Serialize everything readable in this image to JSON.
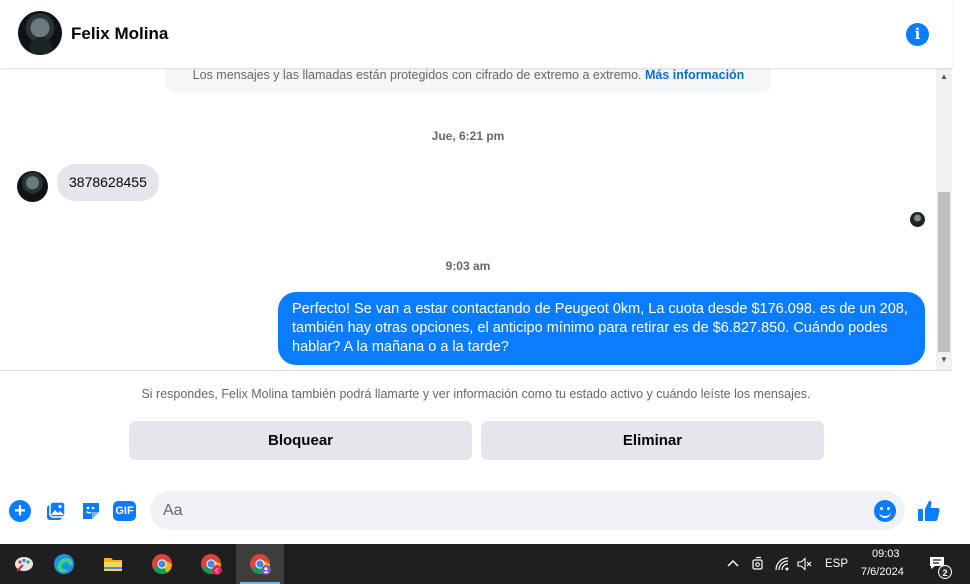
{
  "header": {
    "contact_name": "Felix Molina",
    "info_icon": "info-icon"
  },
  "thread": {
    "e2ee_text": "Los mensajes y las llamadas están protegidos con cifrado de extremo a extremo.",
    "e2ee_link": "Más información",
    "timestamp_1": "Jue, 6:21 pm",
    "incoming_message": "3878628455",
    "timestamp_2": "9:03 am",
    "outgoing_message": "Perfecto!  Se van a estar contactando de Peugeot 0km, La cuota desde $176.098. es de un 208, también hay otras opciones, el anticipo mínimo para retirar es de $6.827.850. Cuándo podes hablar? A la mañana o a la tarde?"
  },
  "request_panel": {
    "notice": "Si respondes, Felix Molina también podrá llamarte y ver información como tu estado activo y cuándo leíste los mensajes.",
    "block_label": "Bloquear",
    "delete_label": "Eliminar"
  },
  "composer": {
    "placeholder": "Aa",
    "gif_label": "GIF",
    "plus_label": "+"
  },
  "taskbar": {
    "language": "ESP",
    "time": "09:03",
    "date": "7/6/2024",
    "notifications_count": "2",
    "apps": [
      "paint-icon",
      "edge-icon",
      "file-explorer-icon",
      "chrome-icon",
      "chrome-profile-c-icon",
      "chrome-profile-active-icon"
    ]
  },
  "colors": {
    "accent": "#0a7cff",
    "bubble_in": "#e4e6eb",
    "taskbar": "#1f1f1f"
  }
}
